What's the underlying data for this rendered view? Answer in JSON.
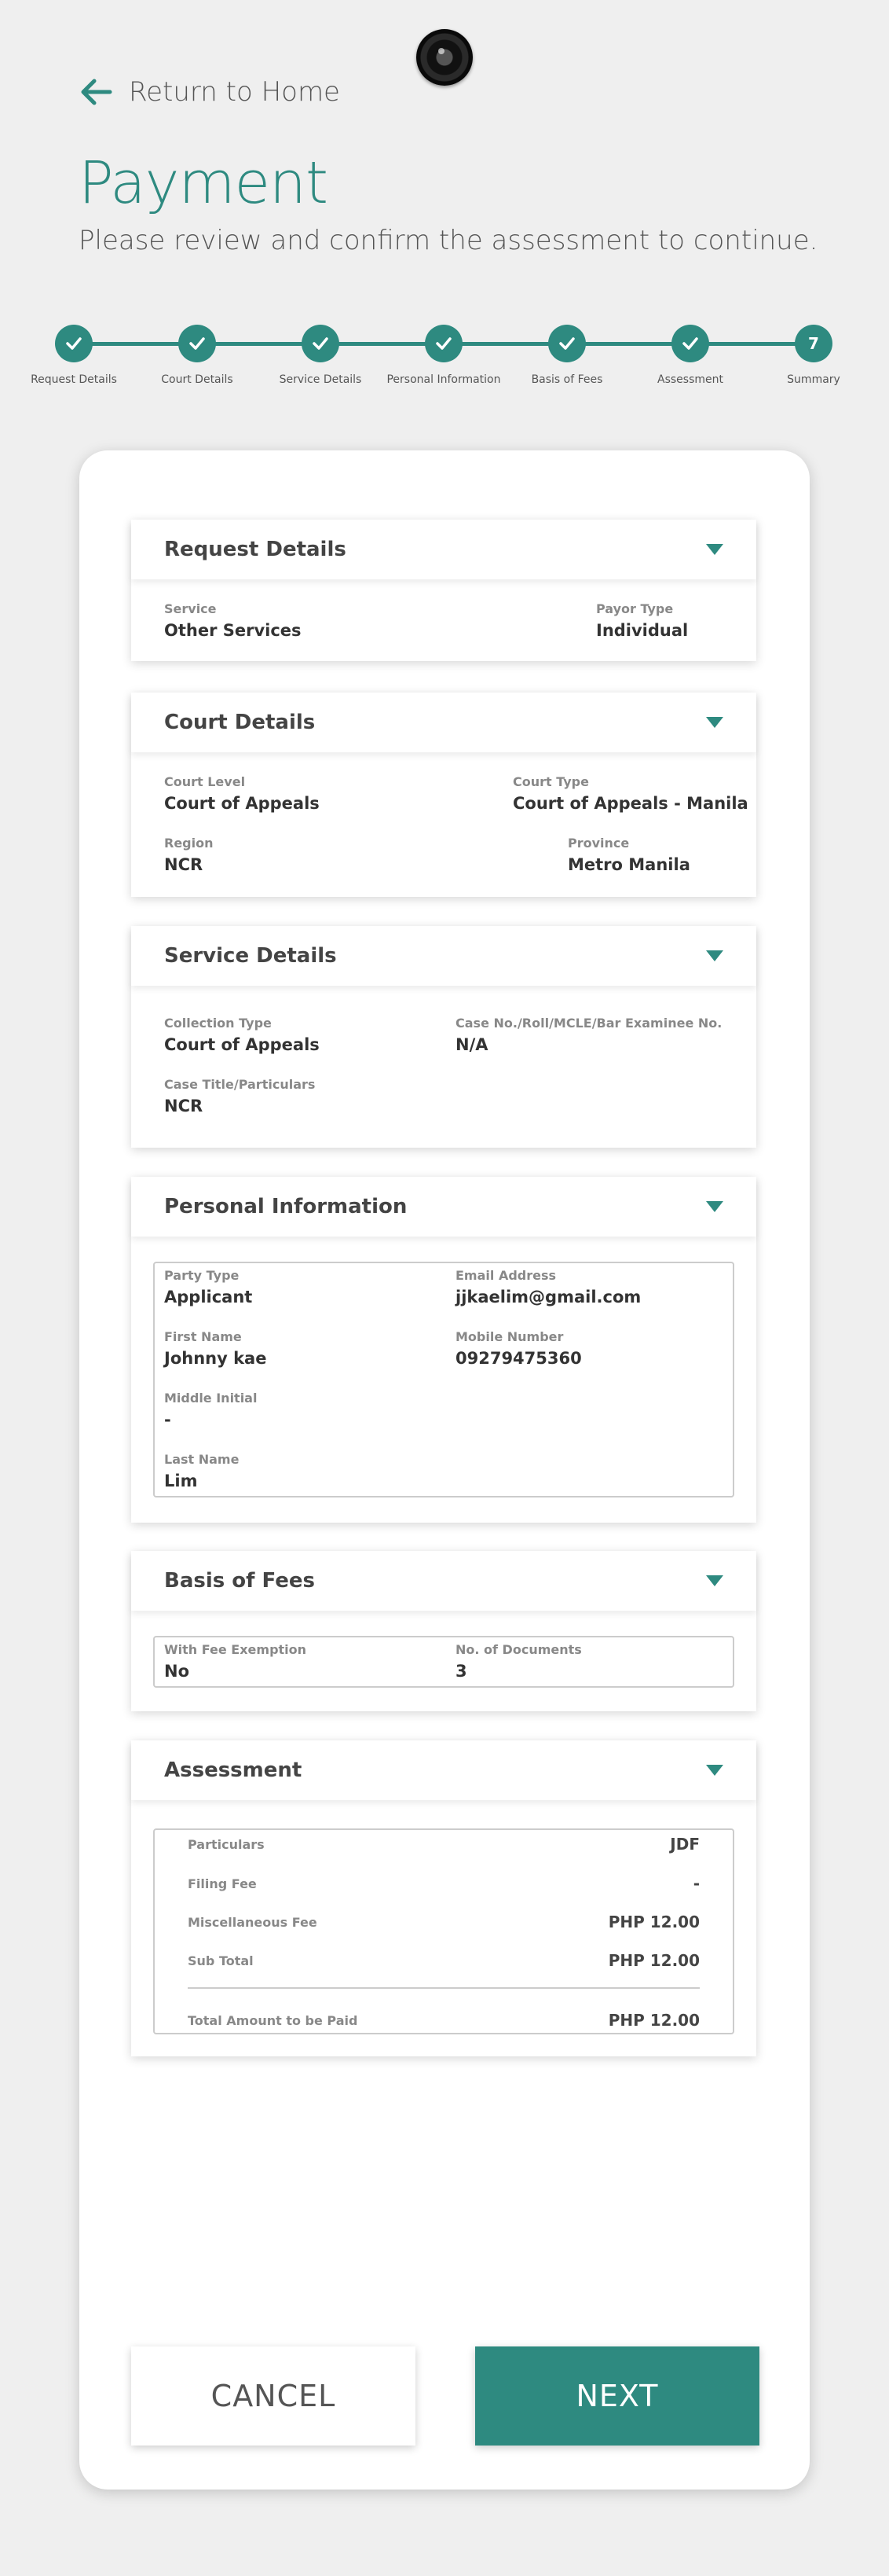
{
  "nav": {
    "back_label": "Return to Home"
  },
  "header": {
    "title": "Payment",
    "subtitle": "Please review and confirm the assessment to continue."
  },
  "stepper": {
    "accent_color": "#2e8a80",
    "steps": [
      {
        "label": "Request Details",
        "state": "complete"
      },
      {
        "label": "Court Details",
        "state": "complete"
      },
      {
        "label": "Service Details",
        "state": "complete"
      },
      {
        "label": "Personal Information",
        "state": "complete"
      },
      {
        "label": "Basis of Fees",
        "state": "complete"
      },
      {
        "label": "Assessment",
        "state": "complete"
      },
      {
        "label": "Summary",
        "state": "current",
        "number": "7"
      }
    ]
  },
  "request_details": {
    "title": "Request Details",
    "service_label": "Service",
    "service_value": "Other Services",
    "payor_label": "Payor Type",
    "payor_value": "Individual"
  },
  "court_details": {
    "title": "Court Details",
    "level_label": "Court Level",
    "level_value": "Court of Appeals",
    "type_label": "Court Type",
    "type_value": "Court of Appeals - Manila",
    "region_label": "Region",
    "region_value": "NCR",
    "province_label": "Province",
    "province_value": "Metro Manila"
  },
  "service_details": {
    "title": "Service Details",
    "collection_label": "Collection Type",
    "collection_value": "Court of Appeals",
    "case_label": "Case No./Roll/MCLE/Bar Examinee No.",
    "case_value": "N/A",
    "title_label": "Case Title/Particulars",
    "title_value": "NCR"
  },
  "personal_info": {
    "title": "Personal Information",
    "party_label": "Party Type",
    "party_value": "Applicant",
    "email_label": "Email Address",
    "email_value": "jjkaelim@gmail.com",
    "first_label": "First Name",
    "first_value": "Johnny kae",
    "mobile_label": "Mobile Number",
    "mobile_value": "09279475360",
    "middle_label": "Middle Initial",
    "middle_value": "-",
    "last_label": "Last Name",
    "last_value": "Lim"
  },
  "basis_of_fees": {
    "title": "Basis of Fees",
    "exemption_label": "With Fee Exemption",
    "exemption_value": "No",
    "docs_label": "No. of Documents",
    "docs_value": "3"
  },
  "assessment": {
    "title": "Assessment",
    "rows": [
      {
        "label": "Particulars",
        "value": "JDF"
      },
      {
        "label": "Filing Fee",
        "value": "-"
      },
      {
        "label": "Miscellaneous Fee",
        "value": "PHP 12.00"
      },
      {
        "label": "Sub Total",
        "value": "PHP 12.00"
      }
    ],
    "total_label": "Total Amount to be Paid",
    "total_value": "PHP 12.00"
  },
  "actions": {
    "cancel_label": "CANCEL",
    "next_label": "NEXT"
  }
}
